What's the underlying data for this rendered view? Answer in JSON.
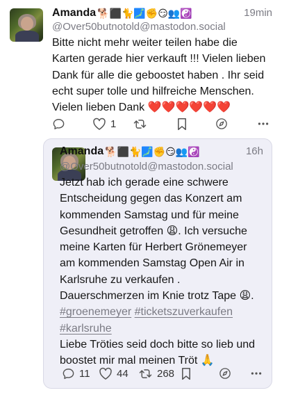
{
  "main_post": {
    "display_name": "Amanda",
    "name_emojis": "🐕‍⬛🐈🗾✊😏👥☯️",
    "handle": "@Over50butnotold@mastodon.social",
    "time": "19min",
    "text": "Bitte nicht mehr weiter teilen habe die Karten gerade hier verkauft !!!  Vielen lieben Dank für alle die geboostet haben . Ihr seid echt super tolle und hilfreiche Menschen. Vielen lieben Dank",
    "hearts": "❤️❤️❤️❤️❤️❤️",
    "actions": {
      "replies": "",
      "favourites": "1",
      "boosts": ""
    }
  },
  "quoted_post": {
    "display_name": "Amanda",
    "name_emojis": "🐕‍⬛🐈🗾✊😏👥☯️",
    "handle": "@Over50butnotold@mastodon.social",
    "time": "16h",
    "text_1": "Jetzt hab ich gerade eine schwere Entscheidung gegen das Konzert am kommenden Samstag und für meine Gesundheit getroffen 😩.  Ich versuche meine Karten für Herbert Grönemeyer am kommenden Samstag Open Air in Karlsruhe zu verkaufen .",
    "text_2": "Dauerschmerzen im Knie trotz Tape 😩.",
    "hashtag_1": "#groenemeyer",
    "hashtag_2": "#ticketszuverkaufen",
    "hashtag_3": "#karlsruhe",
    "text_3": "Liebe Tröties seid doch bitte so lieb und boostet  mir mal meinen Tröt 🙏",
    "actions": {
      "replies": "11",
      "favourites": "44",
      "boosts": "268"
    }
  },
  "icons": {
    "reply": "reply-icon",
    "favourite": "heart-icon",
    "boost": "boost-icon",
    "bookmark": "bookmark-icon",
    "share": "compass-icon",
    "more": "more-icon"
  },
  "colors": {
    "hearts": "#e0242f",
    "muted": "#7b7b84",
    "quote_bg": "#efeff7"
  }
}
